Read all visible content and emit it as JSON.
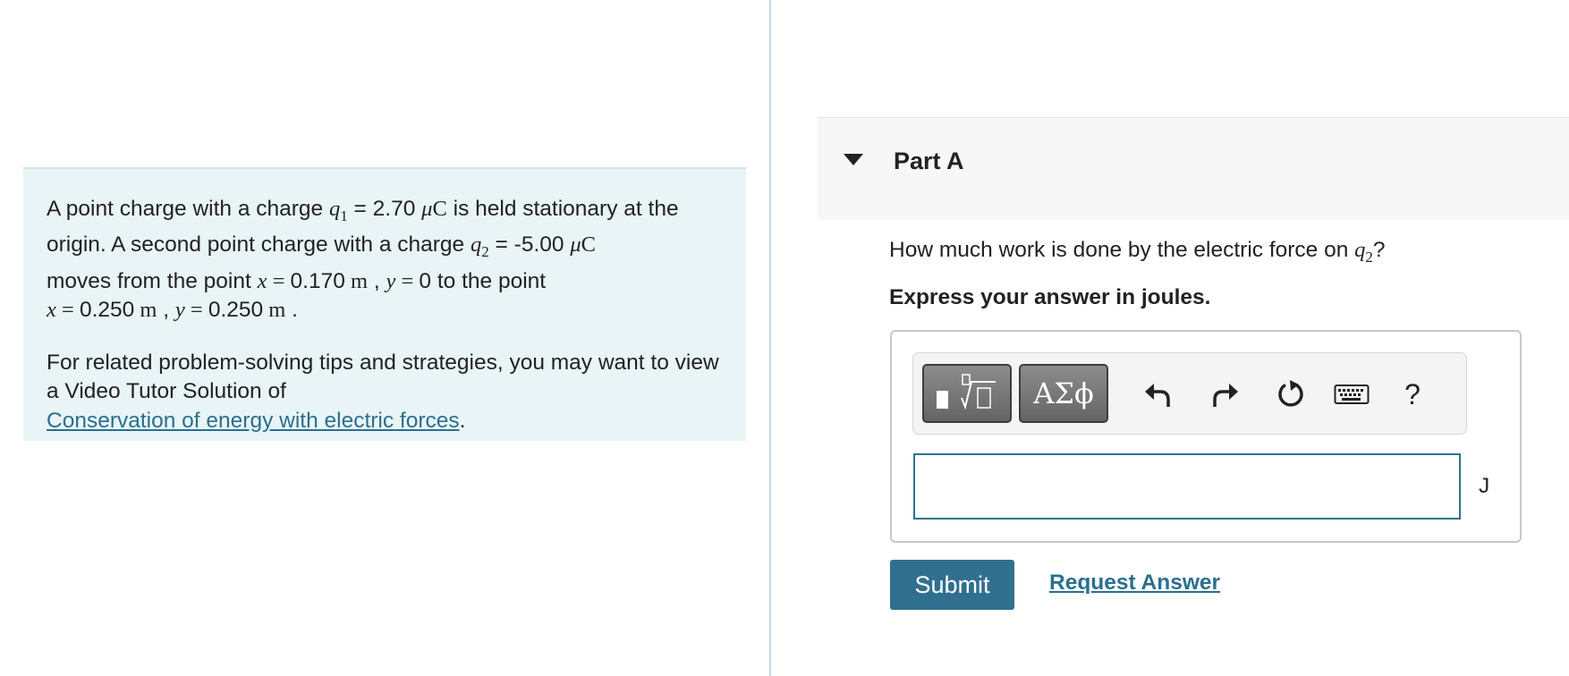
{
  "problem": {
    "s1_a": "A point charge with a charge ",
    "q1_symbol": "q",
    "q1_sub": "1",
    "s1_b": " = 2.70 ",
    "unit_mu": "μ",
    "unit_C": "C",
    "s1_c": " is held stationary at the origin. A second point charge with a charge ",
    "q2_symbol": "q",
    "q2_sub": "2",
    "s1_d": " = -5.00 ",
    "s1_e": " moves from the point ",
    "x_symbol": "x",
    "y_symbol": "y",
    "eq_sign": " = ",
    "x1_value": "0.170",
    "meter": " m",
    "comma": " , ",
    "y1_value": "0",
    "s1_f": " to the point",
    "x2_value": "0.250",
    "y2_value": "0.250",
    "period": " .",
    "tip_text": "For related problem-solving tips and strategies, you may want to view a Video Tutor Solution of",
    "tip_link": "Conservation of energy with electric forces",
    "tip_end": "."
  },
  "part": {
    "title": "Part A",
    "question_pre": "How much work is done by the electric force on ",
    "question_var": "q",
    "question_sub": "2",
    "question_post": "?",
    "instruction": "Express your answer in joules.",
    "unit": "J"
  },
  "toolbar": {
    "greek_label": "ΑΣϕ",
    "help_label": "?",
    "icons": [
      "templates-icon",
      "undo-icon",
      "redo-icon",
      "reset-icon",
      "keyboard-icon"
    ]
  },
  "answer": {
    "value": "",
    "placeholder": ""
  },
  "actions": {
    "submit_label": "Submit",
    "request_label": "Request Answer"
  },
  "colors": {
    "panel_bg": "#e9f4f6",
    "primary": "#316f8f",
    "link": "#2a6f8f",
    "header_bg": "#f7f7f7"
  }
}
